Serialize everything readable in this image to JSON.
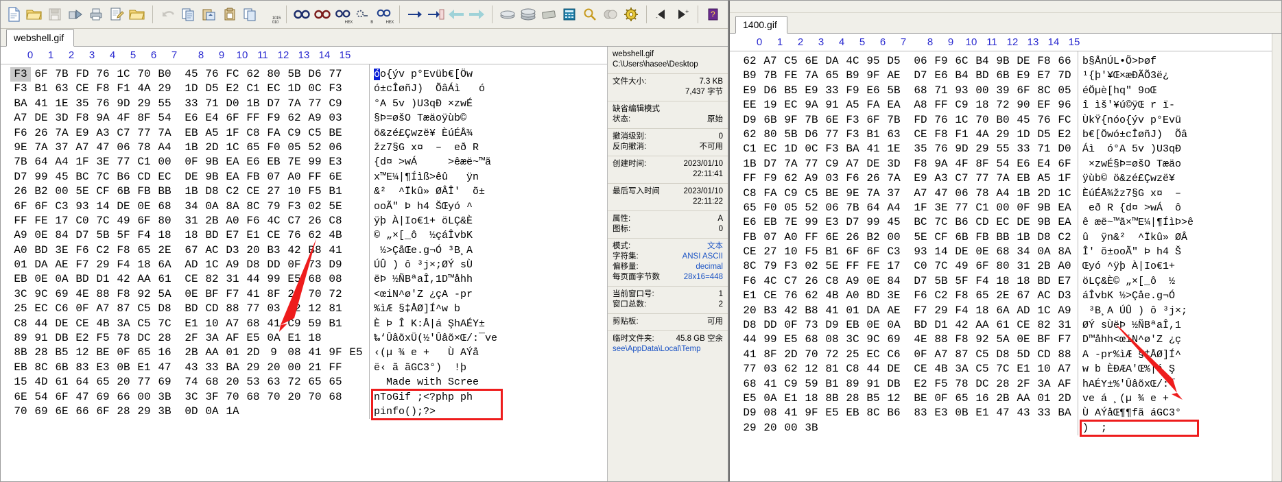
{
  "app": {
    "title": "WinHex - hex editor"
  },
  "toolbar": {
    "groups": [
      {
        "buttons": [
          {
            "name": "new-file-icon",
            "label": "New"
          },
          {
            "name": "open-folder-icon",
            "label": "Open"
          },
          {
            "name": "save-icon",
            "label": "Save"
          },
          {
            "name": "save-as-icon",
            "label": "Save As"
          },
          {
            "name": "print-icon",
            "label": "Print"
          },
          {
            "name": "edit-doc-icon",
            "label": "Edit"
          },
          {
            "name": "open-folder2-icon",
            "label": "Open Folder"
          }
        ]
      },
      {
        "buttons": [
          {
            "name": "undo-icon",
            "label": "Undo"
          },
          {
            "name": "copy-icon",
            "label": "Copy"
          },
          {
            "name": "paste-into-icon",
            "label": "Paste Into"
          },
          {
            "name": "clipboard-icon",
            "label": "Clipboard"
          },
          {
            "name": "copy-block-icon",
            "label": "Copy Block"
          },
          {
            "name": "binary-icon",
            "label": "1015 010"
          }
        ]
      },
      {
        "buttons": [
          {
            "name": "find-icon",
            "label": "Find"
          },
          {
            "name": "find-next-icon",
            "label": "Find Next"
          },
          {
            "name": "find-hex-icon",
            "label": "Find Hex"
          },
          {
            "name": "replace-text-icon",
            "label": "Replace Text"
          },
          {
            "name": "replace-hex-icon",
            "label": "Replace Hex"
          }
        ]
      },
      {
        "buttons": [
          {
            "name": "goto-icon",
            "label": "Go To"
          },
          {
            "name": "goto-offset-icon",
            "label": "Go To Offset"
          },
          {
            "name": "back-icon",
            "label": "Back"
          },
          {
            "name": "forward-icon",
            "label": "Forward"
          }
        ]
      },
      {
        "buttons": [
          {
            "name": "disk-icon",
            "label": "Open Disk"
          },
          {
            "name": "disks-icon",
            "label": "Disks"
          },
          {
            "name": "ram-icon",
            "label": "RAM Editor"
          },
          {
            "name": "calculator-icon",
            "label": "Calculator"
          },
          {
            "name": "analyze-icon",
            "label": "Analyze"
          },
          {
            "name": "compare-icon",
            "label": "Compare"
          },
          {
            "name": "options-icon",
            "label": "Options"
          }
        ]
      },
      {
        "buttons": [
          {
            "name": "prev-position-icon",
            "label": "Previous"
          },
          {
            "name": "next-position-icon",
            "label": "Next"
          }
        ]
      },
      {
        "buttons": [
          {
            "name": "help-icon",
            "label": "Help"
          }
        ]
      }
    ]
  },
  "column_headers": [
    "0",
    "1",
    "2",
    "3",
    "4",
    "5",
    "6",
    "7",
    "8",
    "9",
    "10",
    "11",
    "12",
    "13",
    "14",
    "15"
  ],
  "left_window": {
    "tab_label": "webshell.gif",
    "hex_rows": [
      [
        "F3",
        "6F",
        "7B",
        "FD",
        "76",
        "1C",
        "70",
        "B0",
        "45",
        "76",
        "FC",
        "62",
        "80",
        "5B",
        "D6",
        "77"
      ],
      [
        "F3",
        "B1",
        "63",
        "CE",
        "F8",
        "F1",
        "4A",
        "29",
        "1D",
        "D5",
        "E2",
        "C1",
        "EC",
        "1D",
        "0C",
        "F3"
      ],
      [
        "BA",
        "41",
        "1E",
        "35",
        "76",
        "9D",
        "29",
        "55",
        "33",
        "71",
        "D0",
        "1B",
        "D7",
        "7A",
        "77",
        "C9"
      ],
      [
        "A7",
        "DE",
        "3D",
        "F8",
        "9A",
        "4F",
        "8F",
        "54",
        "E6",
        "E4",
        "6F",
        "FF",
        "F9",
        "62",
        "A9",
        "03"
      ],
      [
        "F6",
        "26",
        "7A",
        "E9",
        "A3",
        "C7",
        "77",
        "7A",
        "EB",
        "A5",
        "1F",
        "C8",
        "FA",
        "C9",
        "C5",
        "BE"
      ],
      [
        "9E",
        "7A",
        "37",
        "A7",
        "47",
        "06",
        "78",
        "A4",
        "1B",
        "2D",
        "1C",
        "65",
        "F0",
        "05",
        "52",
        "06"
      ],
      [
        "7B",
        "64",
        "A4",
        "1F",
        "3E",
        "77",
        "C1",
        "00",
        "0F",
        "9B",
        "EA",
        "E6",
        "EB",
        "7E",
        "99",
        "E3"
      ],
      [
        "D7",
        "99",
        "45",
        "BC",
        "7C",
        "B6",
        "CD",
        "EC",
        "DE",
        "9B",
        "EA",
        "FB",
        "07",
        "A0",
        "FF",
        "6E"
      ],
      [
        "26",
        "B2",
        "00",
        "5E",
        "CF",
        "6B",
        "FB",
        "BB",
        "1B",
        "D8",
        "C2",
        "CE",
        "27",
        "10",
        "F5",
        "B1"
      ],
      [
        "6F",
        "6F",
        "C3",
        "93",
        "14",
        "DE",
        "0E",
        "68",
        "34",
        "0A",
        "8A",
        "8C",
        "79",
        "F3",
        "02",
        "5E"
      ],
      [
        "FF",
        "FE",
        "17",
        "C0",
        "7C",
        "49",
        "6F",
        "80",
        "31",
        "2B",
        "A0",
        "F6",
        "4C",
        "C7",
        "26",
        "C8"
      ],
      [
        "A9",
        "0E",
        "84",
        "D7",
        "5B",
        "5F",
        "F4",
        "18",
        "18",
        "BD",
        "E7",
        "E1",
        "CE",
        "76",
        "62",
        "4B"
      ],
      [
        "A0",
        "BD",
        "3E",
        "F6",
        "C2",
        "F8",
        "65",
        "2E",
        "67",
        "AC",
        "D3",
        "20",
        "B3",
        "42",
        "B8",
        "41"
      ],
      [
        "01",
        "DA",
        "AE",
        "F7",
        "29",
        "F4",
        "18",
        "6A",
        "AD",
        "1C",
        "A9",
        "D8",
        "DD",
        "0F",
        "73",
        "D9"
      ],
      [
        "EB",
        "0E",
        "0A",
        "BD",
        "D1",
        "42",
        "AA",
        "61",
        "CE",
        "82",
        "31",
        "44",
        "99",
        "E5",
        "68",
        "08"
      ],
      [
        "3C",
        "9C",
        "69",
        "4E",
        "88",
        "F8",
        "92",
        "5A",
        "0E",
        "BF",
        "F7",
        "41",
        "8F",
        "2D",
        "70",
        "72"
      ],
      [
        "25",
        "EC",
        "C6",
        "0F",
        "A7",
        "87",
        "C5",
        "D8",
        "BD",
        "CD",
        "88",
        "77",
        "03",
        "62",
        "12",
        "81"
      ],
      [
        "C8",
        "44",
        "DE",
        "CE",
        "4B",
        "3A",
        "C5",
        "7C",
        "E1",
        "10",
        "A7",
        "68",
        "41",
        "C9",
        "59",
        "B1"
      ],
      [
        "89",
        "91",
        "DB",
        "E2",
        "F5",
        "78",
        "DC",
        "28",
        "2F",
        "3A",
        "AF",
        "E5",
        "0A",
        "E1",
        "18"
      ],
      [
        "8B",
        "28",
        "B5",
        "12",
        "BE",
        "0F",
        "65",
        "16",
        "2B",
        "AA",
        "01",
        "2D",
        "9",
        "08",
        "41",
        "9F",
        "E5"
      ],
      [
        "EB",
        "8C",
        "6B",
        "83",
        "E3",
        "0B",
        "E1",
        "47",
        "43",
        "33",
        "BA",
        "29",
        "20",
        "00",
        "21",
        "FF"
      ],
      [
        "15",
        "4D",
        "61",
        "64",
        "65",
        "20",
        "77",
        "69",
        "74",
        "68",
        "20",
        "53",
        "63",
        "72",
        "65",
        "65"
      ],
      [
        "6E",
        "54",
        "6F",
        "47",
        "69",
        "66",
        "00",
        "3B",
        "3C",
        "3F",
        "70",
        "68",
        "70",
        "20",
        "70",
        "68"
      ],
      [
        "70",
        "69",
        "6E",
        "66",
        "6F",
        "28",
        "29",
        "3B",
        "0D",
        "0A",
        "1A"
      ]
    ],
    "ascii_rows": [
      "óo{ýv p°Evüb€[Öw",
      "ó±cÎøñJ)  ÕâÁì   ó",
      "°A 5v )U3qÐ ×zwÉ",
      "§Þ=øšO Tæäoÿùb©",
      "ö&zé£Çwzë¥ ÈúÉÅ¾",
      "žz7§G x¤  –  eð R",
      "{d¤ >wÁ     >êæë~™ã",
      "x™E¼|¶Íìß>êû   ÿn",
      "&²  ^Ïkû» ØÂÎ'  õ±",
      "ooÃ\" Þ h4 ŠŒyó ^",
      "ÿþ À|Io€1+ öLÇ&È",
      "© „×[_ô  ½çáÎvbK",
      " ½>ÇåŒe.g¬Ó ³B¸A",
      "ÚÛ ) ô ³j×;ØÝ sÙ",
      "ëÞ ½ÑBªaÎ,1D™åhh",
      "<œiN^ø'Z ¿çA -pr",
      "%ìÆ §‡ÅØ]Í^w b",
      "È Þ Î K:Å|á ŞhAÉY±",
      "‰‘ÛâõxÜ(½'Ûâõ×Œ/:¯ve",
      "‹(µ ¾ e +   Ù AÝå",
      "ë‹ ã ãGC3°)  !þ",
      "  Made with Scree",
      "nToGif ;<?php ph",
      "pinfo();?>"
    ],
    "selected_byte_row": 0,
    "selected_byte_col": 0,
    "annotation_box": {
      "text": "nToGif ;<?php phpinfo();?>",
      "color": "#ee1c1c"
    }
  },
  "info_panel": {
    "file_name": "webshell.gif",
    "file_path": "C:\\Users\\hasee\\Desktop",
    "rows": [
      {
        "key": "文件大小:",
        "value": "7.3 KB",
        "value2": "7,437 字节"
      },
      {
        "key": "缺省编辑模式",
        "value": ""
      },
      {
        "key": "状态:",
        "value": "原始"
      },
      {
        "key": "撤消级别:",
        "value": "0"
      },
      {
        "key": "反向撤消:",
        "value": "不可用"
      },
      {
        "key": "创建时间:",
        "value": "2023/01/10",
        "value2": "22:11:41"
      },
      {
        "key": "最后写入时间",
        "value": "2023/01/10",
        "value2": "22:11:22"
      },
      {
        "key": "属性:",
        "value": "A"
      },
      {
        "key": "图标:",
        "value": "0"
      },
      {
        "key": "模式:",
        "value": "文本",
        "blue": true
      },
      {
        "key": "字符集:",
        "value": "ANSI ASCII",
        "blue": true
      },
      {
        "key": "偏移量:",
        "value": "decimal",
        "blue": true
      },
      {
        "key": "每页面字节数",
        "value": "28x16=448",
        "blue": true
      },
      {
        "key": "当前窗口号:",
        "value": "1"
      },
      {
        "key": "窗口总数:",
        "value": "2"
      },
      {
        "key": "剪贴板:",
        "value": "可用"
      },
      {
        "key": "临时文件夹:",
        "value": "45.8 GB 空余"
      },
      {
        "key": "",
        "value": "see\\AppData\\Local\\Temp",
        "blue": true
      }
    ]
  },
  "right_window": {
    "tab_label": "1400.gif",
    "hex_rows": [
      [
        "62",
        "A7",
        "C5",
        "6E",
        "DA",
        "4C",
        "95",
        "D5",
        "06",
        "F9",
        "6C",
        "B4",
        "9B",
        "DE",
        "F8",
        "66"
      ],
      [
        "B9",
        "7B",
        "FE",
        "7A",
        "65",
        "B9",
        "9F",
        "AE",
        "D7",
        "E6",
        "B4",
        "BD",
        "6B",
        "E9",
        "E7",
        "7D"
      ],
      [
        "E9",
        "D6",
        "B5",
        "E9",
        "33",
        "F9",
        "E6",
        "5B",
        "68",
        "71",
        "93",
        "00",
        "39",
        "6F",
        "8C",
        "05"
      ],
      [
        "EE",
        "19",
        "EC",
        "9A",
        "91",
        "A5",
        "FA",
        "EA",
        "A8",
        "FF",
        "C9",
        "18",
        "72",
        "90",
        "EF",
        "96"
      ],
      [
        "D9",
        "6B",
        "9F",
        "7B",
        "6E",
        "F3",
        "6F",
        "7B",
        "FD",
        "76",
        "1C",
        "70",
        "B0",
        "45",
        "76",
        "FC"
      ],
      [
        "62",
        "80",
        "5B",
        "D6",
        "77",
        "F3",
        "B1",
        "63",
        "CE",
        "F8",
        "F1",
        "4A",
        "29",
        "1D",
        "D5",
        "E2"
      ],
      [
        "C1",
        "EC",
        "1D",
        "0C",
        "F3",
        "BA",
        "41",
        "1E",
        "35",
        "76",
        "9D",
        "29",
        "55",
        "33",
        "71",
        "D0"
      ],
      [
        "1B",
        "D7",
        "7A",
        "77",
        "C9",
        "A7",
        "DE",
        "3D",
        "F8",
        "9A",
        "4F",
        "8F",
        "54",
        "E6",
        "E4",
        "6F"
      ],
      [
        "FF",
        "F9",
        "62",
        "A9",
        "03",
        "F6",
        "26",
        "7A",
        "E9",
        "A3",
        "C7",
        "77",
        "7A",
        "EB",
        "A5",
        "1F"
      ],
      [
        "C8",
        "FA",
        "C9",
        "C5",
        "BE",
        "9E",
        "7A",
        "37",
        "A7",
        "47",
        "06",
        "78",
        "A4",
        "1B",
        "2D",
        "1C"
      ],
      [
        "65",
        "F0",
        "05",
        "52",
        "06",
        "7B",
        "64",
        "A4",
        "1F",
        "3E",
        "77",
        "C1",
        "00",
        "0F",
        "9B",
        "EA"
      ],
      [
        "E6",
        "EB",
        "7E",
        "99",
        "E3",
        "D7",
        "99",
        "45",
        "BC",
        "7C",
        "B6",
        "CD",
        "EC",
        "DE",
        "9B",
        "EA"
      ],
      [
        "FB",
        "07",
        "A0",
        "FF",
        "6E",
        "26",
        "B2",
        "00",
        "5E",
        "CF",
        "6B",
        "FB",
        "BB",
        "1B",
        "D8",
        "C2"
      ],
      [
        "CE",
        "27",
        "10",
        "F5",
        "B1",
        "6F",
        "6F",
        "C3",
        "93",
        "14",
        "DE",
        "0E",
        "68",
        "34",
        "0A",
        "8A"
      ],
      [
        "8C",
        "79",
        "F3",
        "02",
        "5E",
        "FF",
        "FE",
        "17",
        "C0",
        "7C",
        "49",
        "6F",
        "80",
        "31",
        "2B",
        "A0"
      ],
      [
        "F6",
        "4C",
        "C7",
        "26",
        "C8",
        "A9",
        "0E",
        "84",
        "D7",
        "5B",
        "5F",
        "F4",
        "18",
        "18",
        "BD",
        "E7"
      ],
      [
        "E1",
        "CE",
        "76",
        "62",
        "4B",
        "A0",
        "BD",
        "3E",
        "F6",
        "C2",
        "F8",
        "65",
        "2E",
        "67",
        "AC",
        "D3"
      ],
      [
        "20",
        "B3",
        "42",
        "B8",
        "41",
        "01",
        "DA",
        "AE",
        "F7",
        "29",
        "F4",
        "18",
        "6A",
        "AD",
        "1C",
        "A9"
      ],
      [
        "D8",
        "DD",
        "0F",
        "73",
        "D9",
        "EB",
        "0E",
        "0A",
        "BD",
        "D1",
        "42",
        "AA",
        "61",
        "CE",
        "82",
        "31"
      ],
      [
        "44",
        "99",
        "E5",
        "68",
        "08",
        "3C",
        "9C",
        "69",
        "4E",
        "88",
        "F8",
        "92",
        "5A",
        "0E",
        "BF",
        "F7"
      ],
      [
        "41",
        "8F",
        "2D",
        "70",
        "72",
        "25",
        "EC",
        "C6",
        "0F",
        "A7",
        "87",
        "C5",
        "D8",
        "5D",
        "CD",
        "88"
      ],
      [
        "77",
        "03",
        "62",
        "12",
        "81",
        "C8",
        "44",
        "DE",
        "CE",
        "4B",
        "3A",
        "C5",
        "7C",
        "E1",
        "10",
        "A7"
      ],
      [
        "68",
        "41",
        "C9",
        "59",
        "B1",
        "89",
        "91",
        "DB",
        "E2",
        "F5",
        "78",
        "DC",
        "28",
        "2F",
        "3A",
        "AF"
      ],
      [
        "E5",
        "0A",
        "E1",
        "18",
        "8B",
        "28",
        "B5",
        "12",
        "BE",
        "0F",
        "65",
        "16",
        "2B",
        "AA",
        "01",
        "2D"
      ],
      [
        "D9",
        "08",
        "41",
        "9F",
        "E5",
        "EB",
        "8C",
        "B6",
        "83",
        "E3",
        "0B",
        "E1",
        "47",
        "43",
        "33",
        "BA"
      ],
      [
        "29",
        "20",
        "00",
        "3B"
      ]
    ],
    "ascii_rows": [
      "b§ÅnÚL•Õ>Þøf",
      "¹{þ'¥Œ×æÐÃÕ3ë¿",
      "éÖµè[hq\" 9oŒ",
      "î ìš'¥ú©ÿŒ r ï-",
      "ÙkŸ{nóo{ýv p°Evü",
      "b€[Öwó±cÎøñJ)  Õâ",
      "Áì  ó°A 5v )U3qÐ",
      " ×zwÉ§Þ=øšO Tæäo",
      "ÿùb© ö&zé£Çwzë¥",
      "ÈúÉÅ¾žz7§G x¤  –",
      " eð R {d¤ >wÁ  ô",
      "ê æë~™ã×™E¼|¶ÍìÞ>ê",
      "û  ÿn&²  ^Ïkû» ØÂ",
      "Î' õ±ooÃ\" Þ h4 Š",
      "Œyó ^ÿþ À|Io€1+",
      "öLÇ&È© „×[_ô  ½",
      "áÎvbK ½>Çåe.g¬Ó",
      " ³B¸A ÚÛ ) ô ³j×;",
      "ØÝ sÙëÞ ½ÑBªaÎ,1",
      "D™åhh<œiN^ø'Z ¿ç",
      "A -pr%ìÆ §‡ÅØ]Í^",
      "w b ÈÐÆA'Œ%|á Ş",
      "hAÉY±%'ÛâõxŒ/:¯",
      "ve á ¸(µ ¾ e +",
      "Ù AÝåŒ¶¶fã áGC3°",
      ")  ;"
    ],
    "annotation_box": {
      "text": "Ù AÝåŒ¶¶fã áGC3°) ;",
      "color": "#ee1c1c"
    }
  }
}
